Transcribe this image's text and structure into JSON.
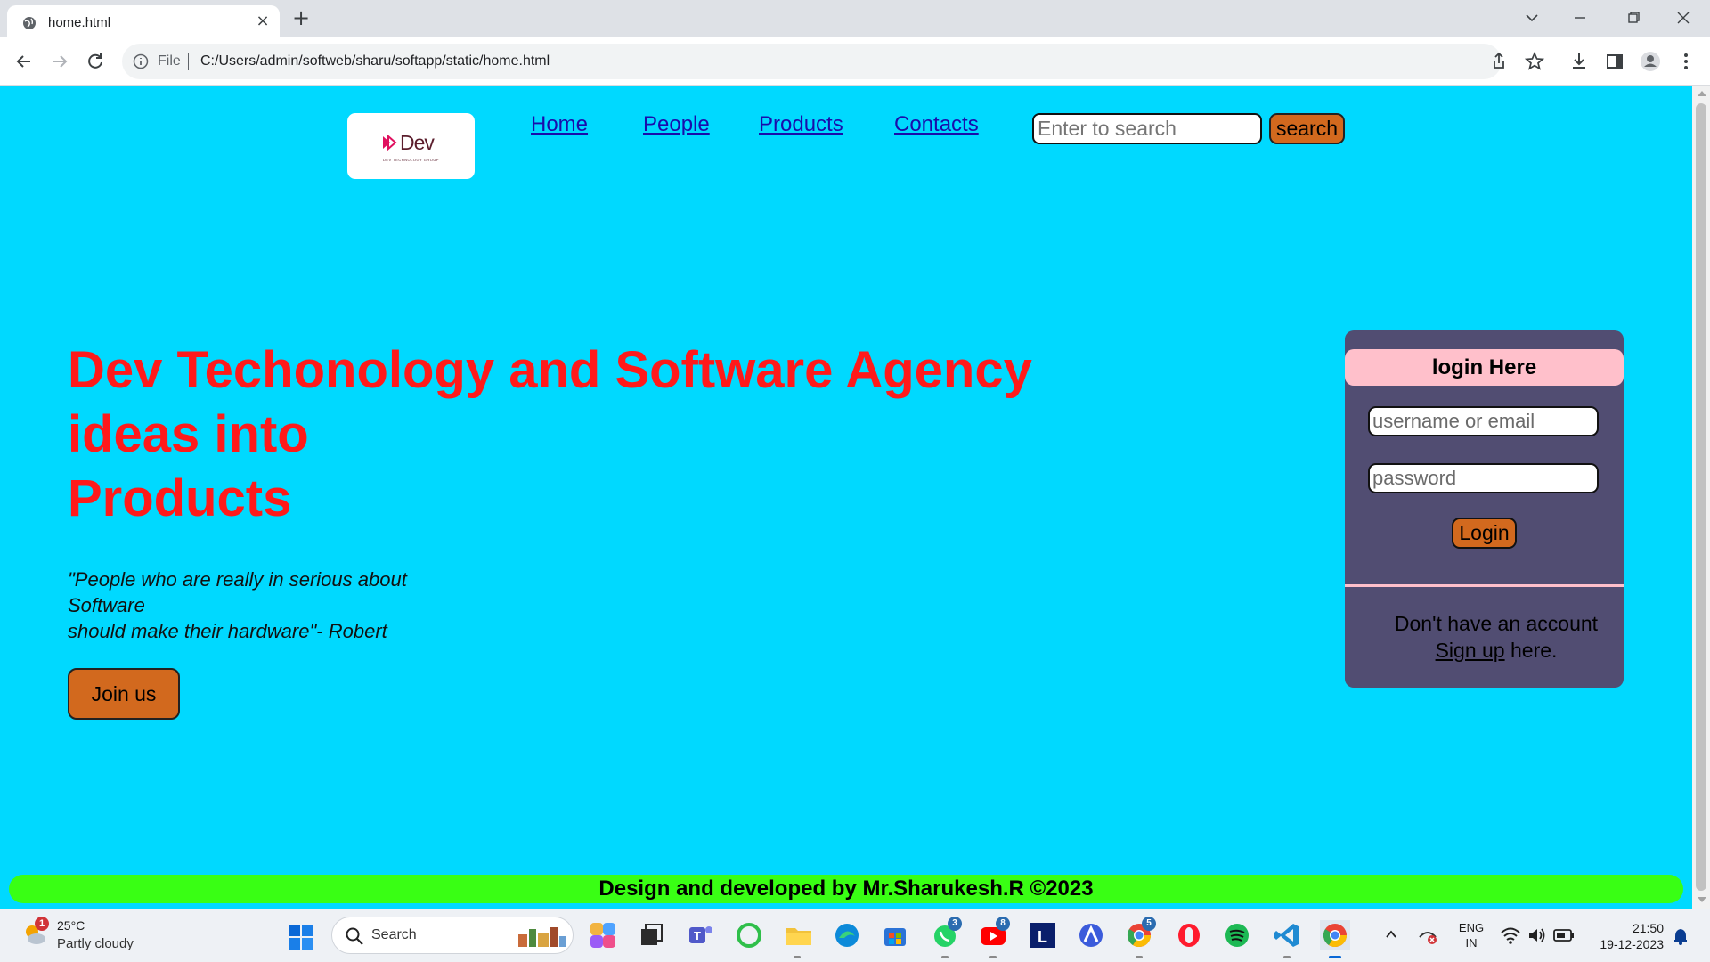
{
  "browser": {
    "tab_title": "home.html",
    "omnibox_scheme": "File",
    "url": "C:/Users/admin/softweb/sharu/softapp/static/home.html"
  },
  "page": {
    "logo": {
      "text": "Dev",
      "sub": "DEV TECHNOLOGY GROUP",
      "brand_color": "#5b1d2c",
      "mark_color": "#e0115f"
    },
    "nav": [
      "Home",
      "People",
      "Products",
      "Contacts"
    ],
    "search": {
      "placeholder": "Enter to search",
      "button": "search"
    },
    "hero": {
      "line1": "Dev Techonology and Software Agency",
      "line2": "ideas into",
      "line3": "Products",
      "quote_line1": "\"People who are really in serious about Software",
      "quote_line2": "should make their hardware\"- Robert",
      "join_button": "Join us"
    },
    "login": {
      "heading": "login Here",
      "username_placeholder": "username or email",
      "password_placeholder": "password",
      "button": "Login",
      "signup_prefix": "Don't have an account",
      "signup_link": "Sign up",
      "signup_suffix": " here."
    },
    "footer": "Design and developed by Mr.Sharukesh.R ©2023",
    "colors": {
      "background": "#00d9ff",
      "accent_button": "#d2691e",
      "heading": "#ff1a1a",
      "card": "#514d72",
      "card_header": "#ffc0cb",
      "footer": "#39ff14",
      "link": "#1a0dab"
    }
  },
  "taskbar": {
    "weather_temp": "25°C",
    "weather_desc": "Partly cloudy",
    "weather_badge": "1",
    "search_label": "Search",
    "apps": [
      "copilot-icon",
      "task-view-icon",
      "teams-icon",
      "circle-app-icon",
      "file-explorer-icon",
      "edge-icon",
      "store-icon",
      "whatsapp-icon",
      "youtube-icon",
      "l-app-icon",
      "arc-app-icon",
      "chrome-alt-icon",
      "opera-icon",
      "spotify-icon",
      "vscode-icon",
      "chrome-icon"
    ],
    "badges": {
      "whatsapp": "3",
      "youtube": "8",
      "chrome_alt": "5"
    },
    "lang_line1": "ENG",
    "lang_line2": "IN",
    "time": "21:50",
    "date": "19-12-2023"
  }
}
